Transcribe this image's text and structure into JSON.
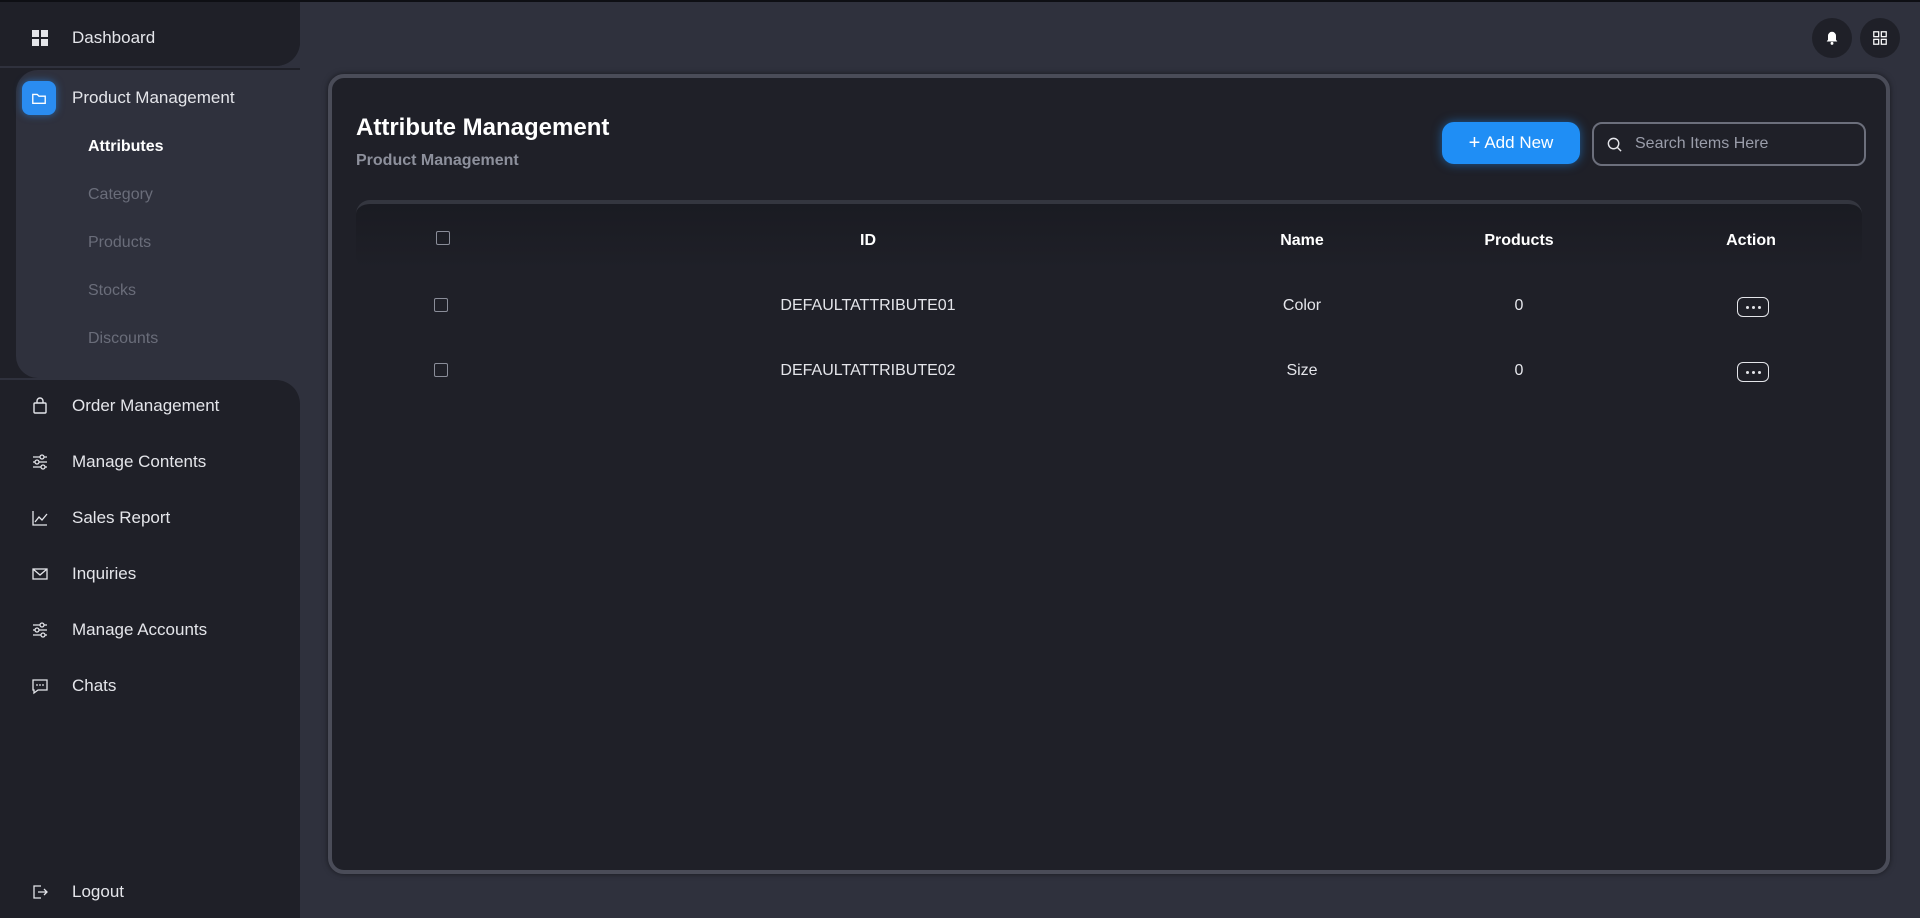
{
  "sidebar": {
    "dashboard": "Dashboard",
    "product_management": "Product Management",
    "sub_items": [
      "Attributes",
      "Category",
      "Products",
      "Stocks",
      "Discounts"
    ],
    "items": [
      "Order Management",
      "Manage Contents",
      "Sales Report",
      "Inquiries",
      "Manage Accounts",
      "Chats"
    ],
    "logout": "Logout"
  },
  "page": {
    "title": "Attribute Management",
    "breadcrumb": "Product Management",
    "add_label": "Add New",
    "search_placeholder": "Search Items Here"
  },
  "table": {
    "headers": {
      "id": "ID",
      "name": "Name",
      "products": "Products",
      "action": "Action"
    },
    "rows": [
      {
        "id": "DEFAULTATTRIBUTE01",
        "name": "Color",
        "products": "0"
      },
      {
        "id": "DEFAULTATTRIBUTE02",
        "name": "Size",
        "products": "0"
      }
    ]
  },
  "colors": {
    "accent": "#1f8ef5",
    "sidebar": "#1f2028",
    "background": "#2f313d"
  }
}
